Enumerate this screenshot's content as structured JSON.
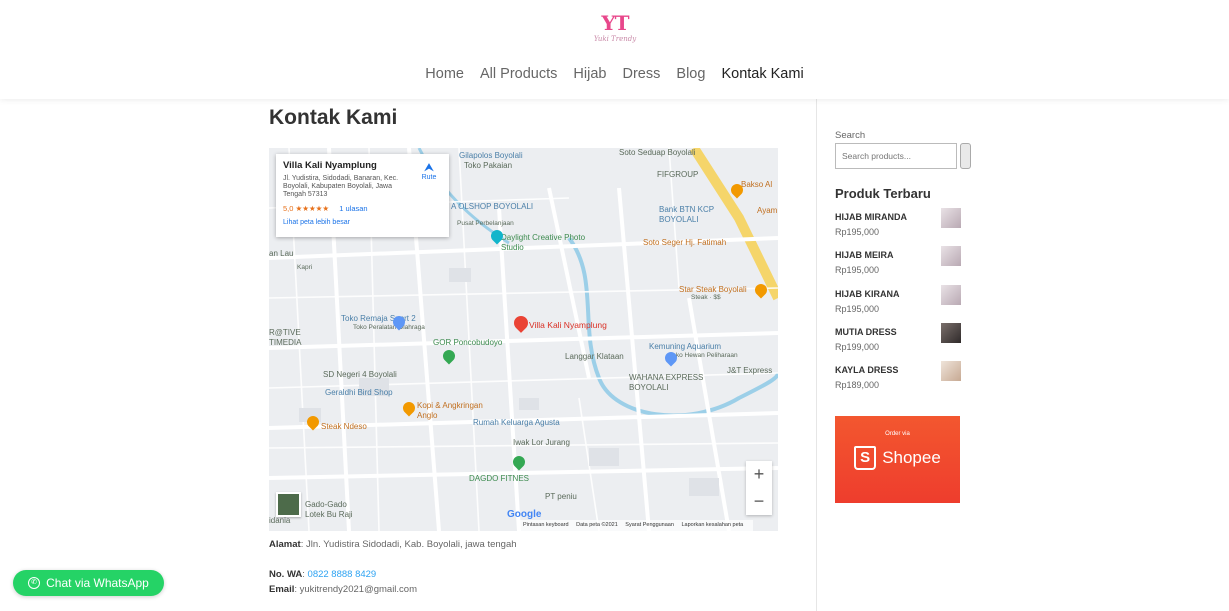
{
  "logo": {
    "mark": "YT",
    "tagline": "Yuki Trendy"
  },
  "nav": [
    {
      "label": "Home"
    },
    {
      "label": "All Products"
    },
    {
      "label": "Hijab"
    },
    {
      "label": "Dress"
    },
    {
      "label": "Blog"
    },
    {
      "label": "Kontak Kami"
    }
  ],
  "page": {
    "title": "Kontak Kami"
  },
  "map": {
    "card": {
      "name": "Villa Kali Nyamplung",
      "address": "Jl. Yudistira, Sidodadi, Banaran, Kec. Boyolali, Kabupaten Boyolali, Jawa Tengah 57313",
      "rating": "5,0 ★★★★★",
      "reviews": "1 ulasan",
      "larger": "Lihat peta lebih besar",
      "route": "Rute"
    },
    "zoom_in": "+",
    "zoom_out": "−",
    "google": "Google",
    "attribution": [
      "Pintasan keyboard",
      "Data peta ©2021",
      "Syarat Penggunaan",
      "Laporkan kesalahan peta"
    ],
    "labels": {
      "villa": "Villa Kali Nyamplung",
      "gilapolos": "Gilapolos Boyolali",
      "pakaian": "Toko Pakaian",
      "soto_sedaap": "Soto Seduap Boyolali",
      "fifgroup": "FIFGROUP",
      "bakso": "Bakso Al",
      "olshop": "A OLSHOP BOYOLALI",
      "perbelanjaan": "Pusat Perbelanjaan",
      "bank_btn": "Bank BTN KCP BOYOLALI",
      "ayam": "Ayam",
      "daylight": "Daylight Creative Photo Studio",
      "soto_fatimah": "Soto Seger Hj. Fatimah",
      "star_steak": "Star Steak Boyolali",
      "steak_price": "Steak · $$",
      "remaja": "Toko Remaja Sport 2",
      "olahraga": "Toko Peralatan Olahraga",
      "gor": "GOR Poncobudoyo",
      "langgar": "Langgar Klataan",
      "kemuning": "Kemuning Aquarium",
      "hewan": "Toko Hewan Peliharaan",
      "wahana": "WAHANA EXPRESS BOYOLALI",
      "jnt": "J&T Express",
      "creative": "R@TIVE TIMEDIA",
      "sd": "SD Negeri 4 Boyolali",
      "geraldhi": "Geraldhi Bird Shop",
      "kopi": "Kopi & Angkringan Anglo",
      "rumah": "Rumah Keluarga Agusta",
      "iwak": "Iwak Lor Jurang",
      "steak_ndeso": "Steak Ndeso",
      "dagdo": "DAGDO FITNES",
      "peniu": "PT peniu",
      "gado": "Gado-Gado Lotek Bu Raji",
      "idania": "idania",
      "lau": "an Lau",
      "kapri": "Kapri"
    }
  },
  "contact": {
    "address_label": "Alamat",
    "address_value": ": Jln. Yudistira Sidodadi, Kab. Boyolali, jawa tengah",
    "wa_label": "No. WA",
    "wa_value": "0822 8888 8429",
    "email_label": "Email",
    "email_value": ": yukitrendy2021@gmail.com"
  },
  "sidebar": {
    "search_label": "Search",
    "search_placeholder": "Search products...",
    "recent_title": "Produk Terbaru",
    "products": [
      {
        "name": "HIJAB MIRANDA",
        "price": "Rp195,000"
      },
      {
        "name": "HIJAB MEIRA",
        "price": "Rp195,000"
      },
      {
        "name": "HIJAB KIRANA",
        "price": "Rp195,000"
      },
      {
        "name": "MUTIA DRESS",
        "price": "Rp199,000"
      },
      {
        "name": "KAYLA DRESS",
        "price": "Rp189,000"
      }
    ],
    "shopee": {
      "order_via": "Order via",
      "brand": "Shopee",
      "mark": "S"
    }
  },
  "whatsapp": {
    "label": "Chat via WhatsApp"
  },
  "colors": {
    "accent": "#2ea3f2",
    "whatsapp": "#25d366",
    "shopee": "#ee4d2d",
    "logo": "#e8478b"
  }
}
